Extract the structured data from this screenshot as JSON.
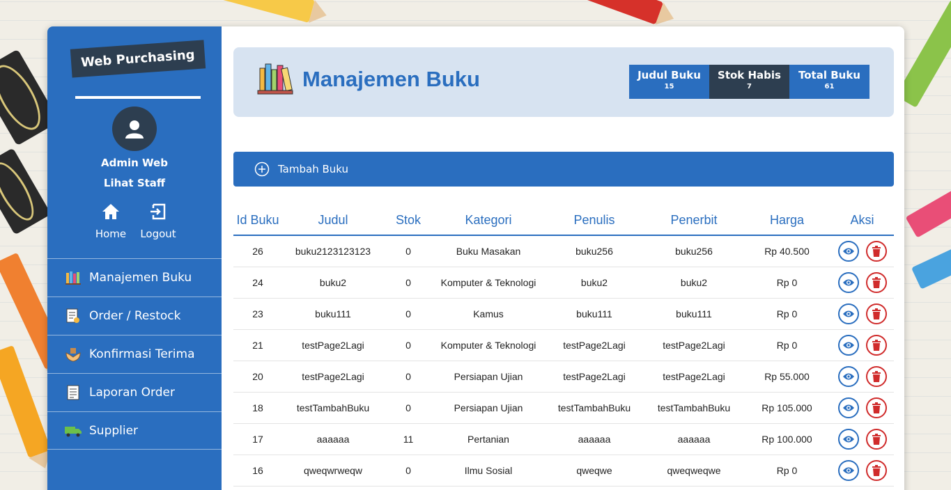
{
  "sidebar": {
    "brand": "Web Purchasing",
    "user_name": "Admin Web",
    "user_role": "Lihat Staff",
    "home_label": "Home",
    "logout_label": "Logout",
    "menu": [
      {
        "label": "Manajemen Buku",
        "icon": "books-icon"
      },
      {
        "label": "Order / Restock",
        "icon": "order-list-icon"
      },
      {
        "label": "Konfirmasi Terima",
        "icon": "hand-box-icon"
      },
      {
        "label": "Laporan Order",
        "icon": "report-icon"
      },
      {
        "label": "Supplier",
        "icon": "truck-icon"
      }
    ]
  },
  "header": {
    "title": "Manajemen Buku",
    "stats": [
      {
        "label": "Judul Buku",
        "value": "15"
      },
      {
        "label": "Stok Habis",
        "value": "7"
      },
      {
        "label": "Total Buku",
        "value": "61"
      }
    ]
  },
  "add_button": "Tambah Buku",
  "table": {
    "columns": [
      "Id Buku",
      "Judul",
      "Stok",
      "Kategori",
      "Penulis",
      "Penerbit",
      "Harga",
      "Aksi"
    ],
    "rows": [
      [
        "26",
        "buku2123123123",
        "0",
        "Buku Masakan",
        "buku256",
        "buku256",
        "Rp 40.500"
      ],
      [
        "24",
        "buku2",
        "0",
        "Komputer & Teknologi",
        "buku2",
        "buku2",
        "Rp 0"
      ],
      [
        "23",
        "buku111",
        "0",
        "Kamus",
        "buku111",
        "buku111",
        "Rp 0"
      ],
      [
        "21",
        "testPage2Lagi",
        "0",
        "Komputer & Teknologi",
        "testPage2Lagi",
        "testPage2Lagi",
        "Rp 0"
      ],
      [
        "20",
        "testPage2Lagi",
        "0",
        "Persiapan Ujian",
        "testPage2Lagi",
        "testPage2Lagi",
        "Rp 55.000"
      ],
      [
        "18",
        "testTambahBuku",
        "0",
        "Persiapan Ujian",
        "testTambahBuku",
        "testTambahBuku",
        "Rp 105.000"
      ],
      [
        "17",
        "aaaaaa",
        "11",
        "Pertanian",
        "aaaaaa",
        "aaaaaa",
        "Rp 100.000"
      ],
      [
        "16",
        "qweqwrweqw",
        "0",
        "Ilmu Sosial",
        "qweqwe",
        "qweqweqwe",
        "Rp 0"
      ]
    ]
  },
  "colors": {
    "primary": "#2a6ebf",
    "dark": "#2d3e50",
    "danger": "#d02b2b",
    "header_bg": "#d7e3f1"
  }
}
